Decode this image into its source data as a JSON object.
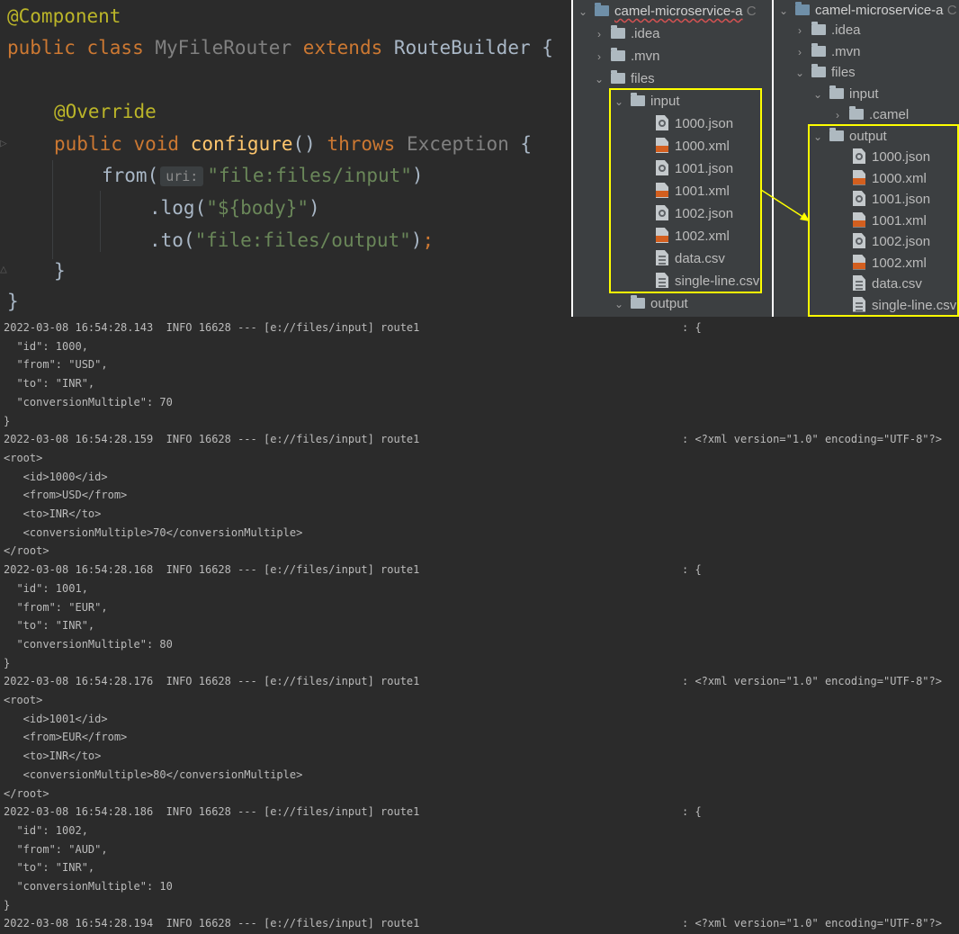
{
  "editor": {
    "lines": [
      {
        "ann": "@Component"
      },
      {
        "kw1": "public class ",
        "cls": "MyFileRouter",
        "kw2": " extends ",
        "base": "RouteBuilder",
        "rest": " {"
      },
      {},
      {
        "ann": "@Override"
      },
      {
        "kw1": "public void ",
        "fn": "configure",
        "mid": "() ",
        "kw2": "throws ",
        "exc": "Exception",
        "rest": " {"
      },
      {
        "pre": "from(",
        "hint": "uri:",
        "str": "\"file:files/input\"",
        "post": ")"
      },
      {
        "pre": ".log(",
        "str": "\"${body}\"",
        "post": ")"
      },
      {
        "pre": ".to(",
        "str": "\"file:files/output\"",
        "post": ")",
        "semi": ";"
      },
      {
        "rest": "}"
      },
      {
        "rest": "}"
      }
    ]
  },
  "tree_before": {
    "project": "camel-microservice-a",
    "project_suffix": "C",
    "idea": ".idea",
    "mvn": ".mvn",
    "files": "files",
    "input": "input",
    "files_list": [
      "1000.json",
      "1000.xml",
      "1001.json",
      "1001.xml",
      "1002.json",
      "1002.xml",
      "data.csv",
      "single-line.csv"
    ],
    "output": "output"
  },
  "tree_after": {
    "project": "camel-microservice-a",
    "project_suffix": "C",
    "idea": ".idea",
    "mvn": ".mvn",
    "files": "files",
    "input": "input",
    "camel": ".camel",
    "output": "output",
    "files_list": [
      "1000.json",
      "1000.xml",
      "1001.json",
      "1001.xml",
      "1002.json",
      "1002.xml",
      "data.csv",
      "single-line.csv"
    ]
  },
  "highlight_color": "#ffff00",
  "console": {
    "lines": [
      {
        "log": "2022-03-08 16:54:28.143  INFO 16628 --- [e://files/input] route1",
        "msg": ": {"
      },
      {
        "text": "  \"id\": 1000,"
      },
      {
        "text": "  \"from\": \"USD\","
      },
      {
        "text": "  \"to\": \"INR\","
      },
      {
        "text": "  \"conversionMultiple\": 70"
      },
      {
        "text": "}"
      },
      {
        "log": "2022-03-08 16:54:28.159  INFO 16628 --- [e://files/input] route1",
        "msg": ": <?xml version=\"1.0\" encoding=\"UTF-8\"?>"
      },
      {
        "text": "<root>"
      },
      {
        "text": "   <id>1000</id>"
      },
      {
        "text": "   <from>USD</from>"
      },
      {
        "text": "   <to>INR</to>"
      },
      {
        "text": "   <conversionMultiple>70</conversionMultiple>"
      },
      {
        "text": "</root>"
      },
      {
        "log": "2022-03-08 16:54:28.168  INFO 16628 --- [e://files/input] route1",
        "msg": ": {"
      },
      {
        "text": "  \"id\": 1001,"
      },
      {
        "text": "  \"from\": \"EUR\","
      },
      {
        "text": "  \"to\": \"INR\","
      },
      {
        "text": "  \"conversionMultiple\": 80"
      },
      {
        "text": "}"
      },
      {
        "log": "2022-03-08 16:54:28.176  INFO 16628 --- [e://files/input] route1",
        "msg": ": <?xml version=\"1.0\" encoding=\"UTF-8\"?>"
      },
      {
        "text": "<root>"
      },
      {
        "text": "   <id>1001</id>"
      },
      {
        "text": "   <from>EUR</from>"
      },
      {
        "text": "   <to>INR</to>"
      },
      {
        "text": "   <conversionMultiple>80</conversionMultiple>"
      },
      {
        "text": "</root>"
      },
      {
        "log": "2022-03-08 16:54:28.186  INFO 16628 --- [e://files/input] route1",
        "msg": ": {"
      },
      {
        "text": "  \"id\": 1002,"
      },
      {
        "text": "  \"from\": \"AUD\","
      },
      {
        "text": "  \"to\": \"INR\","
      },
      {
        "text": "  \"conversionMultiple\": 10"
      },
      {
        "text": "}"
      },
      {
        "log": "2022-03-08 16:54:28.194  INFO 16628 --- [e://files/input] route1",
        "msg": ": <?xml version=\"1.0\" encoding=\"UTF-8\"?>"
      }
    ]
  }
}
